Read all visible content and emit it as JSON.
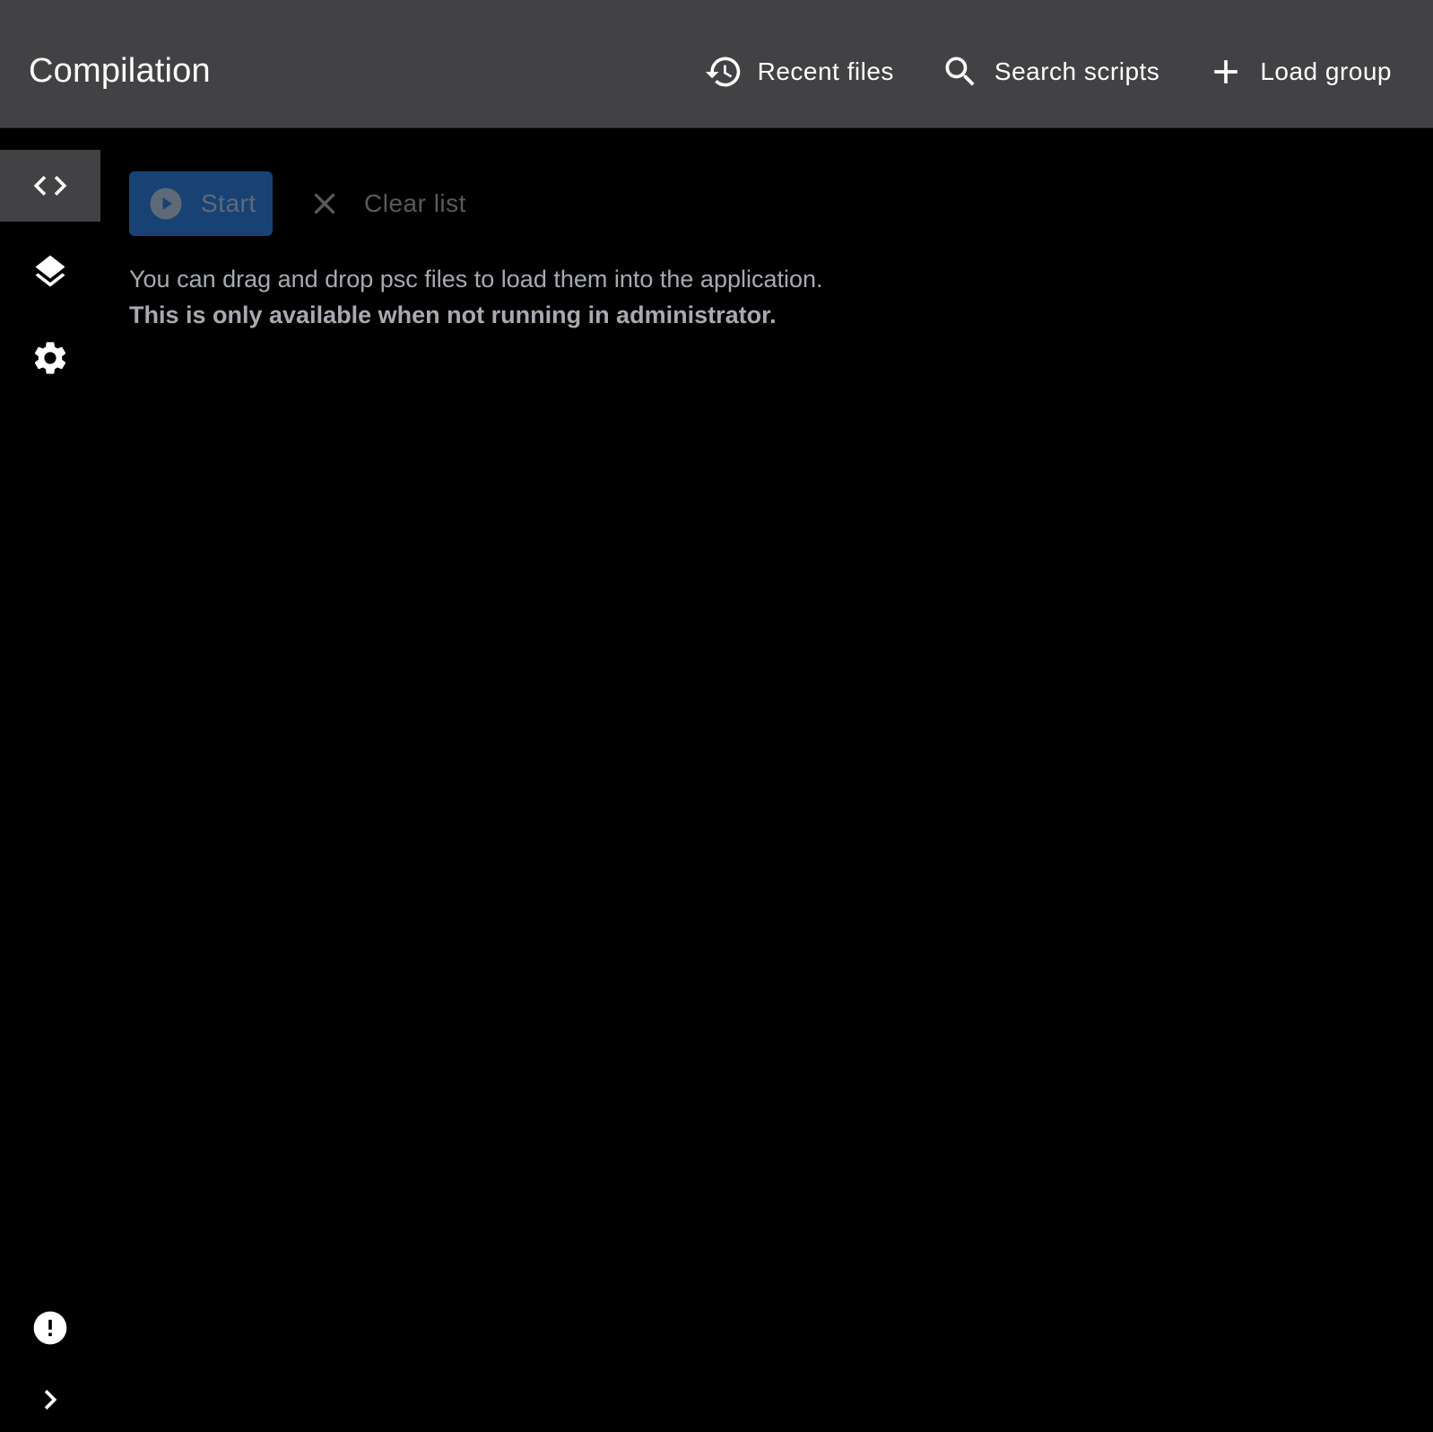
{
  "app": {
    "title": "Compilation"
  },
  "header": {
    "actions": [
      {
        "label": "Recent files",
        "icon": "history-icon"
      },
      {
        "label": "Search scripts",
        "icon": "search-icon"
      },
      {
        "label": "Load group",
        "icon": "plus-icon"
      }
    ]
  },
  "sidebar": {
    "items": [
      {
        "name": "compilation",
        "icon": "code-icon",
        "active": true
      },
      {
        "name": "groups",
        "icon": "layers-icon",
        "active": false
      },
      {
        "name": "settings",
        "icon": "gear-icon",
        "active": false
      }
    ],
    "bottom": [
      {
        "name": "errors",
        "icon": "alert-icon"
      },
      {
        "name": "expand",
        "icon": "chevron-right-icon"
      }
    ]
  },
  "toolbar": {
    "start_label": "Start",
    "clear_label": "Clear list"
  },
  "info": {
    "line1": "You can drag and drop psc files to load them into the application.",
    "line2": "This is only available when not running in administrator."
  },
  "colors": {
    "header_bg": "#424144",
    "body_bg": "#000000",
    "start_bg": "#184274",
    "text_muted": "#a7aab0"
  }
}
